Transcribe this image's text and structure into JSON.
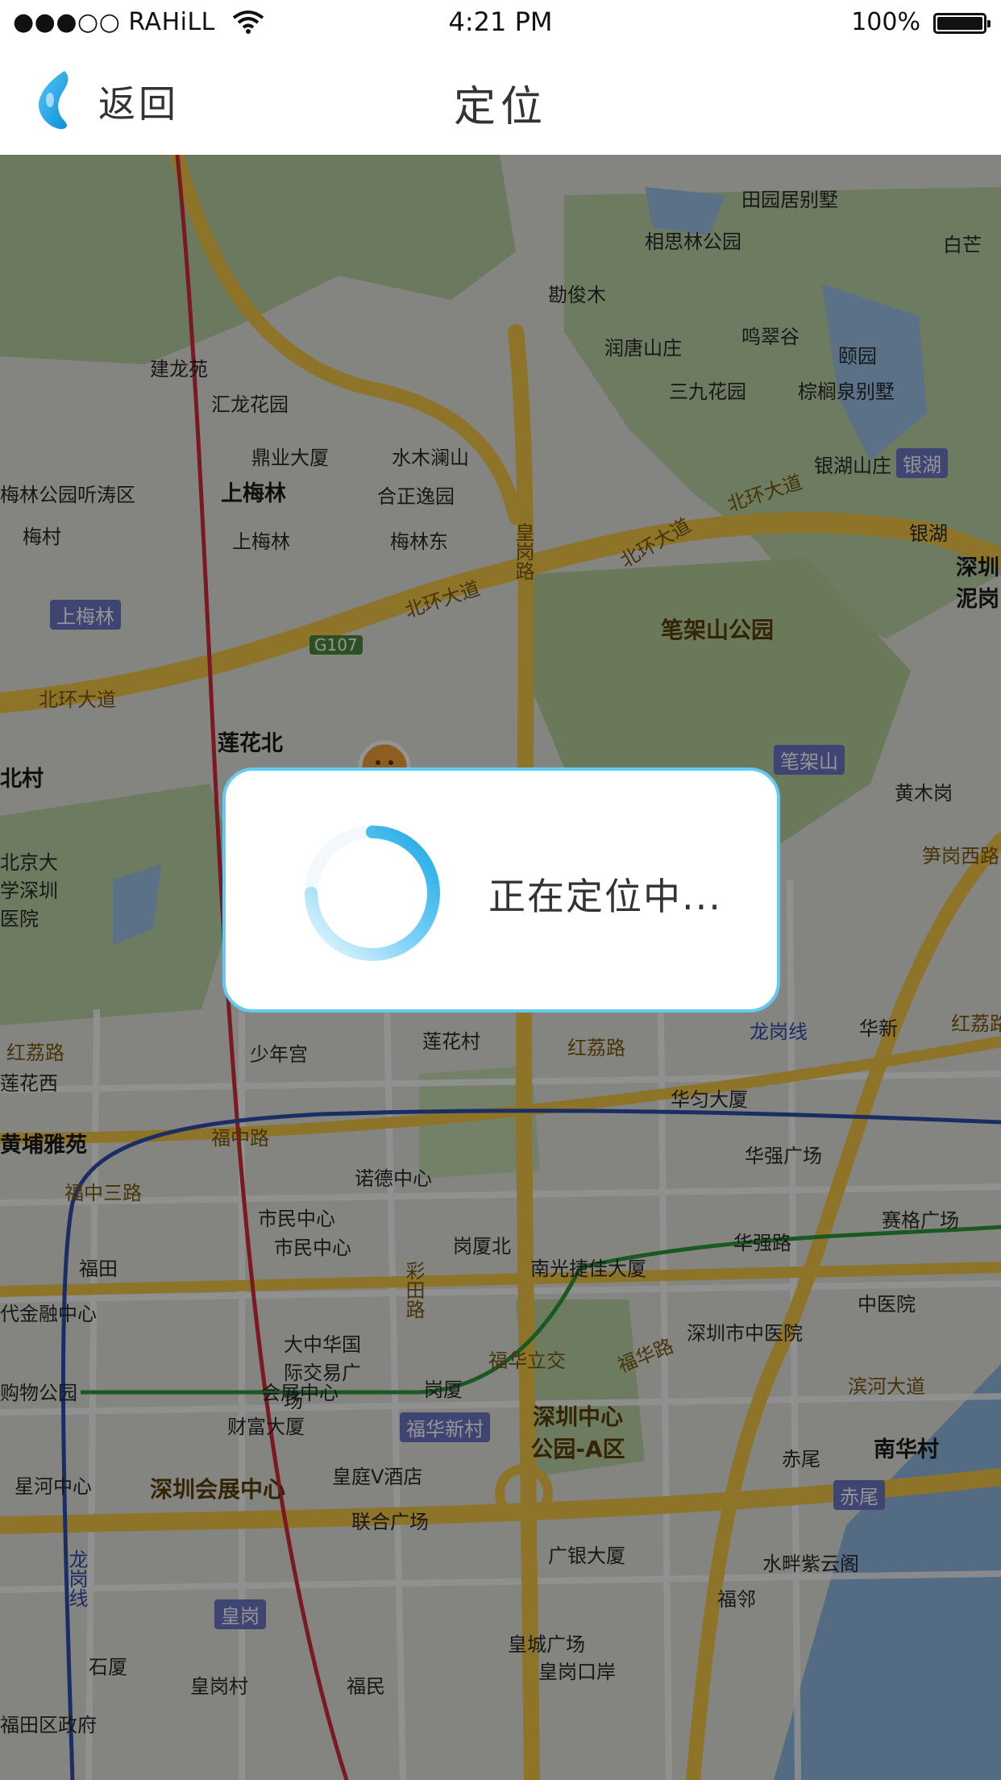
{
  "status_bar": {
    "carrier": "●●●○○ RAHiLL",
    "time": "4:21 PM",
    "battery": "100%"
  },
  "nav": {
    "back_label": "返回",
    "title": "定位",
    "logo_color": "#1aa7e6"
  },
  "loading": {
    "text": "正在定位中...",
    "accent": "#1aa7e6"
  },
  "map": {
    "labels": {
      "l1": "田园居别墅",
      "l2": "相思林公园",
      "l3": "勘俊木",
      "l4": "润唐山庄",
      "l5": "鸣翠谷",
      "l6": "颐园",
      "l7": "三九花园",
      "l8": "棕榈泉别墅",
      "l9": "银湖山庄",
      "l10": "银湖",
      "l11": "建龙苑",
      "l12": "汇龙花园",
      "l13": "鼎业大厦",
      "l14": "水木澜山",
      "l15": "合正逸园",
      "l16": "上梅林",
      "l17": "梅林公园听涛区",
      "l18": "梅村",
      "l19": "上梅林",
      "l20": "梅林东",
      "l21": "皇岗路",
      "l22": "北环大道",
      "l23": "北环大道",
      "l24": "北环大道",
      "l25": "银湖",
      "l26": "深圳泥岗",
      "l27": "上梅林",
      "l28": "G107",
      "l29": "笔架山公园",
      "l30": "北环大道",
      "l31": "莲花北",
      "l32": "北村",
      "l33": "笔架山",
      "l34": "黄木岗",
      "l35": "北京大学深圳医院",
      "l36": "笋岗西路",
      "l37": "红荔路",
      "l38": "少年宫",
      "l39": "莲花村",
      "l40": "红荔路",
      "l41": "龙岗线",
      "l42": "华新",
      "l43": "红荔路",
      "l44": "莲花西",
      "l45": "华匀大厦",
      "l46": "黄埔雅苑",
      "l47": "福中路",
      "l48": "诺德中心",
      "l49": "华强广场",
      "l50": "福中三路",
      "l51": "市民中心",
      "l52": "市民中心",
      "l53": "岗厦北",
      "l54": "赛格广场",
      "l55": "福田",
      "l56": "华强路",
      "l57": "南光捷佳大厦",
      "l58": "代金融中心",
      "l59": "彩田路",
      "l60": "中医院",
      "l61": "大中华国际交易广场",
      "l62": "深圳市中医院",
      "l63": "福华立交",
      "l64": "福华路",
      "l65": "购物公园",
      "l66": "会展中心",
      "l67": "岗厦",
      "l68": "滨河大道",
      "l69": "财富大厦",
      "l70": "福华新村",
      "l71": "深圳中心公园-A区",
      "l72": "星河中心",
      "l73": "皇庭V酒店",
      "l74": "赤尾",
      "l75": "南华村",
      "l76": "深圳会展中心",
      "l77": "联合广场",
      "l78": "赤尾",
      "l79": "广银大厦",
      "l80": "水畔紫云阁",
      "l81": "龙岗线",
      "l82": "皇岗",
      "l83": "福邻",
      "l84": "皇城广场",
      "l85": "石厦",
      "l86": "皇岗村",
      "l87": "福民",
      "l88": "皇岗口岸",
      "l89": "福田区政府",
      "l90": "白芒"
    }
  }
}
